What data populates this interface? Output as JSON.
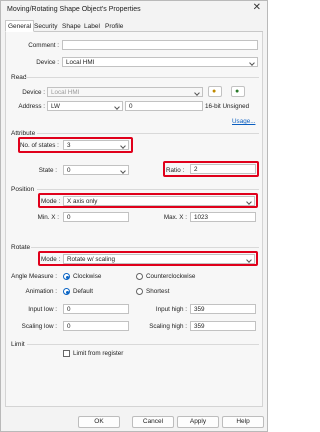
{
  "window": {
    "title": "Moving/Rotating Shape Object's Properties",
    "close_glyph": "✕"
  },
  "tabs": [
    "General",
    "Security",
    "Shape",
    "Label",
    "Profile"
  ],
  "general": {
    "comment_label": "Comment :",
    "comment_value": "",
    "device_label": "Device :",
    "device_value": "Local HMI"
  },
  "read": {
    "group": "Read",
    "device_label": "Device :",
    "device_value": "Local HMI",
    "address_label": "Address :",
    "address_type": "LW",
    "address_value": "0",
    "format": "16-bit Unsigned",
    "usage_link": "Usage..."
  },
  "attribute": {
    "group": "Attribute",
    "states_label": "No. of states :",
    "states_value": "3",
    "state_label": "State :",
    "state_value": "0",
    "ratio_label": "Ratio :",
    "ratio_value": "2"
  },
  "position": {
    "group": "Position",
    "mode_label": "Mode :",
    "mode_value": "X axis only",
    "minx_label": "Min. X :",
    "minx_value": "0",
    "maxx_label": "Max. X :",
    "maxx_value": "1023"
  },
  "rotate": {
    "group": "Rotate",
    "mode_label": "Mode :",
    "mode_value": "Rotate w/ scaling",
    "angle_label": "Angle Measure :",
    "angle_options": [
      "Clockwise",
      "Counterclockwise"
    ],
    "angle_selected": "Clockwise",
    "animation_label": "Animation :",
    "animation_options": [
      "Default",
      "Shortest"
    ],
    "animation_selected": "Default",
    "input_low_label": "Input low :",
    "input_low_value": "0",
    "input_high_label": "Input high :",
    "input_high_value": "359",
    "scaling_low_label": "Scaling low :",
    "scaling_low_value": "0",
    "scaling_high_label": "Scaling high :",
    "scaling_high_value": "359"
  },
  "limit": {
    "group": "Limit",
    "checkbox_label": "Limit from register",
    "checked": false
  },
  "buttons": {
    "ok": "OK",
    "cancel": "Cancel",
    "apply": "Apply",
    "help": "Help"
  },
  "colors": {
    "highlight_box": "#e0001b",
    "link": "#0a5ec0",
    "radio_on": "#0a64c4"
  }
}
